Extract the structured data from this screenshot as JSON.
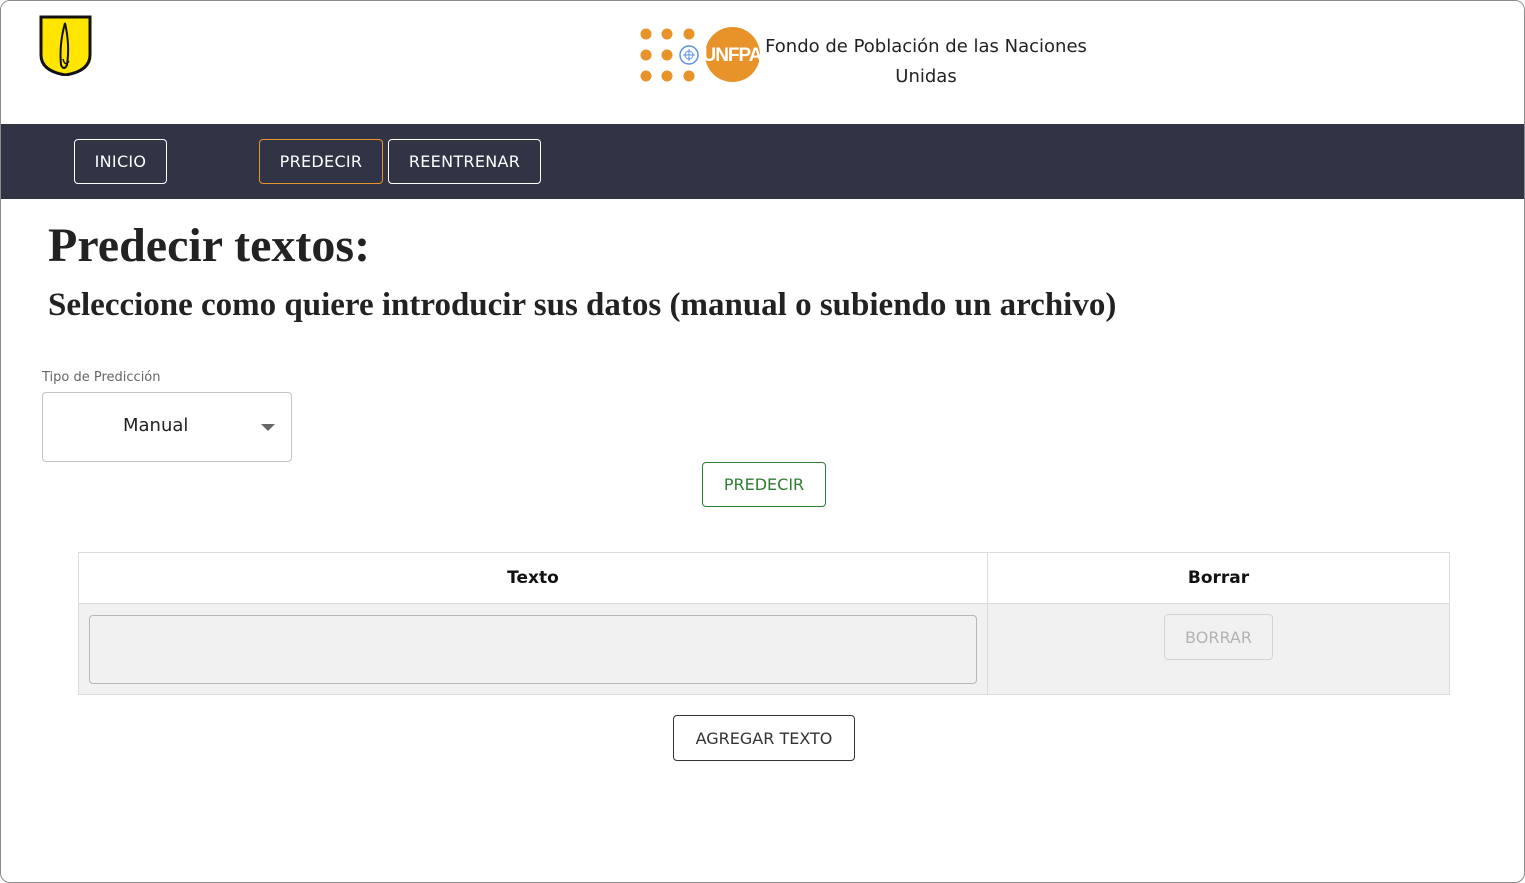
{
  "header": {
    "logo_left_icon": "uniandes-shield-logo",
    "logo_right_icon": "unfpa-logo",
    "unfpa_logo_text": "UNFPA",
    "org_name_line1": "Fondo de Población de las Naciones",
    "org_name_line2": "Unidas"
  },
  "nav": {
    "items": [
      {
        "label": "INICIO",
        "active": false
      },
      {
        "label": "PREDECIR",
        "active": true
      },
      {
        "label": "REENTRENAR",
        "active": false
      }
    ],
    "background_color": "#313445",
    "active_border_color": "#e8932b"
  },
  "main": {
    "title": "Predecir textos:",
    "subtitle": "Seleccione como quiere introducir sus datos (manual o subiendo un archivo)",
    "prediction_type": {
      "label": "Tipo de Predicción",
      "selected": "Manual"
    },
    "predict_button": "PREDECIR",
    "table": {
      "headers": [
        "Texto",
        "Borrar"
      ],
      "rows": [
        {
          "text": "",
          "delete_label": "BORRAR"
        }
      ]
    },
    "add_text_button": "AGREGAR TEXTO"
  },
  "colors": {
    "predict_green": "#2e7d32",
    "unfpa_orange": "#e8922a",
    "uniandes_yellow": "#ffe600"
  }
}
